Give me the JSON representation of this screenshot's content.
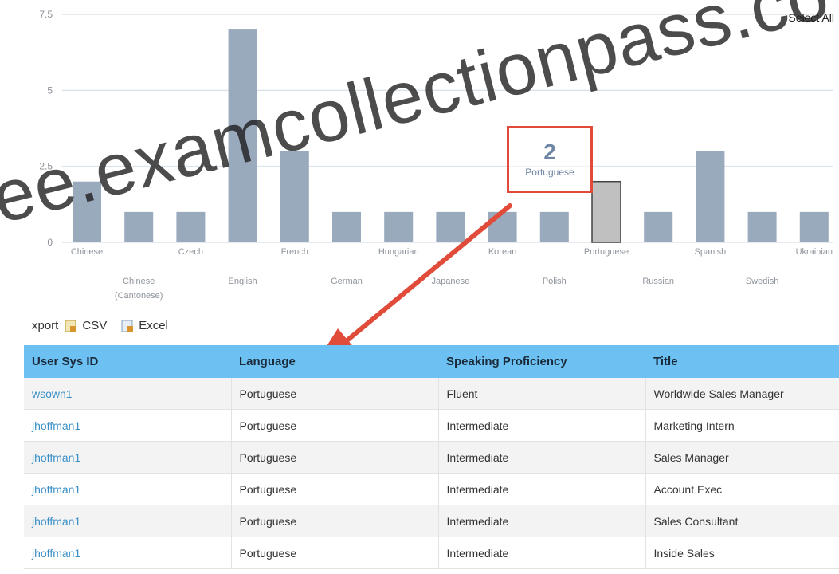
{
  "chart_data": {
    "type": "bar",
    "categories": [
      "Chinese",
      "Chinese (Cantonese)",
      "Czech",
      "English",
      "French",
      "German",
      "Hungarian",
      "Japanese",
      "Korean",
      "Polish",
      "Portuguese",
      "Russian",
      "Spanish",
      "Swedish",
      "Ukrainian"
    ],
    "values": [
      2,
      1,
      1,
      7,
      3,
      1,
      1,
      1,
      1,
      1,
      2,
      1,
      3,
      1,
      1
    ],
    "highlighted_category": "Portuguese",
    "ylim": [
      0,
      7.5
    ],
    "yticks": [
      "0",
      "2.5",
      "5",
      "7.5"
    ],
    "bar_color": "#9aaabd",
    "highlight_color": "#c0c0c0",
    "grid": true
  },
  "select_all_label": "Select All",
  "tooltip": {
    "value": "2",
    "label": "Portuguese"
  },
  "watermark": "ee.examcollectionpass.co",
  "export": {
    "label": "xport",
    "csv": "CSV",
    "excel": "Excel"
  },
  "table": {
    "headers": [
      "User Sys ID",
      "Language",
      "Speaking Proficiency",
      "Title"
    ],
    "rows": [
      [
        "wsown1",
        "Portuguese",
        "Fluent",
        "Worldwide Sales Manager"
      ],
      [
        "jhoffman1",
        "Portuguese",
        "Intermediate",
        "Marketing Intern"
      ],
      [
        "jhoffman1",
        "Portuguese",
        "Intermediate",
        "Sales Manager"
      ],
      [
        "jhoffman1",
        "Portuguese",
        "Intermediate",
        "Account Exec"
      ],
      [
        "jhoffman1",
        "Portuguese",
        "Intermediate",
        "Sales Consultant"
      ],
      [
        "jhoffman1",
        "Portuguese",
        "Intermediate",
        "Inside Sales"
      ]
    ]
  },
  "colors": {
    "header_bg": "#6cc1f2",
    "link": "#3a8fc7",
    "arrow": "#e04b3a"
  }
}
